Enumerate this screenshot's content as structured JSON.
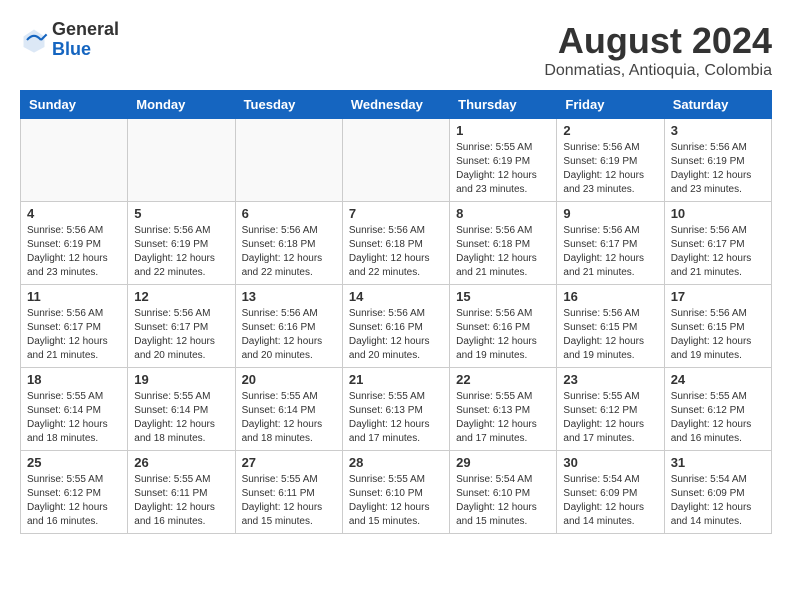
{
  "header": {
    "logo_line1": "General",
    "logo_line2": "Blue",
    "main_title": "August 2024",
    "subtitle": "Donmatias, Antioquia, Colombia"
  },
  "days_of_week": [
    "Sunday",
    "Monday",
    "Tuesday",
    "Wednesday",
    "Thursday",
    "Friday",
    "Saturday"
  ],
  "weeks": [
    [
      {
        "day": "",
        "info": ""
      },
      {
        "day": "",
        "info": ""
      },
      {
        "day": "",
        "info": ""
      },
      {
        "day": "",
        "info": ""
      },
      {
        "day": "1",
        "info": "Sunrise: 5:55 AM\nSunset: 6:19 PM\nDaylight: 12 hours\nand 23 minutes."
      },
      {
        "day": "2",
        "info": "Sunrise: 5:56 AM\nSunset: 6:19 PM\nDaylight: 12 hours\nand 23 minutes."
      },
      {
        "day": "3",
        "info": "Sunrise: 5:56 AM\nSunset: 6:19 PM\nDaylight: 12 hours\nand 23 minutes."
      }
    ],
    [
      {
        "day": "4",
        "info": "Sunrise: 5:56 AM\nSunset: 6:19 PM\nDaylight: 12 hours\nand 23 minutes."
      },
      {
        "day": "5",
        "info": "Sunrise: 5:56 AM\nSunset: 6:19 PM\nDaylight: 12 hours\nand 22 minutes."
      },
      {
        "day": "6",
        "info": "Sunrise: 5:56 AM\nSunset: 6:18 PM\nDaylight: 12 hours\nand 22 minutes."
      },
      {
        "day": "7",
        "info": "Sunrise: 5:56 AM\nSunset: 6:18 PM\nDaylight: 12 hours\nand 22 minutes."
      },
      {
        "day": "8",
        "info": "Sunrise: 5:56 AM\nSunset: 6:18 PM\nDaylight: 12 hours\nand 21 minutes."
      },
      {
        "day": "9",
        "info": "Sunrise: 5:56 AM\nSunset: 6:17 PM\nDaylight: 12 hours\nand 21 minutes."
      },
      {
        "day": "10",
        "info": "Sunrise: 5:56 AM\nSunset: 6:17 PM\nDaylight: 12 hours\nand 21 minutes."
      }
    ],
    [
      {
        "day": "11",
        "info": "Sunrise: 5:56 AM\nSunset: 6:17 PM\nDaylight: 12 hours\nand 21 minutes."
      },
      {
        "day": "12",
        "info": "Sunrise: 5:56 AM\nSunset: 6:17 PM\nDaylight: 12 hours\nand 20 minutes."
      },
      {
        "day": "13",
        "info": "Sunrise: 5:56 AM\nSunset: 6:16 PM\nDaylight: 12 hours\nand 20 minutes."
      },
      {
        "day": "14",
        "info": "Sunrise: 5:56 AM\nSunset: 6:16 PM\nDaylight: 12 hours\nand 20 minutes."
      },
      {
        "day": "15",
        "info": "Sunrise: 5:56 AM\nSunset: 6:16 PM\nDaylight: 12 hours\nand 19 minutes."
      },
      {
        "day": "16",
        "info": "Sunrise: 5:56 AM\nSunset: 6:15 PM\nDaylight: 12 hours\nand 19 minutes."
      },
      {
        "day": "17",
        "info": "Sunrise: 5:56 AM\nSunset: 6:15 PM\nDaylight: 12 hours\nand 19 minutes."
      }
    ],
    [
      {
        "day": "18",
        "info": "Sunrise: 5:55 AM\nSunset: 6:14 PM\nDaylight: 12 hours\nand 18 minutes."
      },
      {
        "day": "19",
        "info": "Sunrise: 5:55 AM\nSunset: 6:14 PM\nDaylight: 12 hours\nand 18 minutes."
      },
      {
        "day": "20",
        "info": "Sunrise: 5:55 AM\nSunset: 6:14 PM\nDaylight: 12 hours\nand 18 minutes."
      },
      {
        "day": "21",
        "info": "Sunrise: 5:55 AM\nSunset: 6:13 PM\nDaylight: 12 hours\nand 17 minutes."
      },
      {
        "day": "22",
        "info": "Sunrise: 5:55 AM\nSunset: 6:13 PM\nDaylight: 12 hours\nand 17 minutes."
      },
      {
        "day": "23",
        "info": "Sunrise: 5:55 AM\nSunset: 6:12 PM\nDaylight: 12 hours\nand 17 minutes."
      },
      {
        "day": "24",
        "info": "Sunrise: 5:55 AM\nSunset: 6:12 PM\nDaylight: 12 hours\nand 16 minutes."
      }
    ],
    [
      {
        "day": "25",
        "info": "Sunrise: 5:55 AM\nSunset: 6:12 PM\nDaylight: 12 hours\nand 16 minutes."
      },
      {
        "day": "26",
        "info": "Sunrise: 5:55 AM\nSunset: 6:11 PM\nDaylight: 12 hours\nand 16 minutes."
      },
      {
        "day": "27",
        "info": "Sunrise: 5:55 AM\nSunset: 6:11 PM\nDaylight: 12 hours\nand 15 minutes."
      },
      {
        "day": "28",
        "info": "Sunrise: 5:55 AM\nSunset: 6:10 PM\nDaylight: 12 hours\nand 15 minutes."
      },
      {
        "day": "29",
        "info": "Sunrise: 5:54 AM\nSunset: 6:10 PM\nDaylight: 12 hours\nand 15 minutes."
      },
      {
        "day": "30",
        "info": "Sunrise: 5:54 AM\nSunset: 6:09 PM\nDaylight: 12 hours\nand 14 minutes."
      },
      {
        "day": "31",
        "info": "Sunrise: 5:54 AM\nSunset: 6:09 PM\nDaylight: 12 hours\nand 14 minutes."
      }
    ]
  ]
}
